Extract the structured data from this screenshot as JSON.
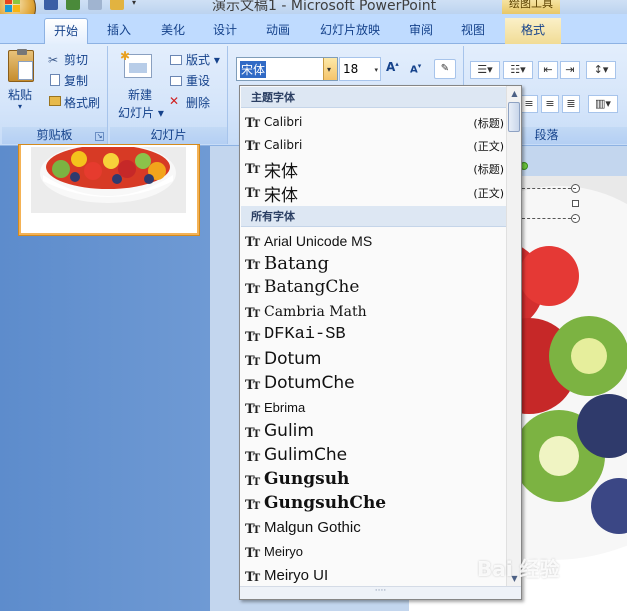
{
  "window": {
    "title": "演示文稿1 - Microsoft PowerPoint",
    "context_tab_group": "绘图工具"
  },
  "tabs": [
    {
      "label": "开始",
      "active": true
    },
    {
      "label": "插入"
    },
    {
      "label": "美化"
    },
    {
      "label": "设计"
    },
    {
      "label": "动画"
    },
    {
      "label": "幻灯片放映"
    },
    {
      "label": "审阅"
    },
    {
      "label": "视图"
    },
    {
      "label": "格式",
      "context": true
    }
  ],
  "ribbon": {
    "clipboard": {
      "paste": "粘贴",
      "cut": "剪切",
      "copy": "复制",
      "format_painter": "格式刷",
      "caption": "剪贴板"
    },
    "slides": {
      "new_slide_line1": "新建",
      "new_slide_line2": "幻灯片 ▾",
      "layout": "版式 ▾",
      "reset": "重设",
      "delete": "删除",
      "caption": "幻灯片"
    },
    "font": {
      "name": "宋体",
      "size": "18"
    },
    "paragraph": {
      "caption": "段落"
    }
  },
  "font_dropdown": {
    "theme_header": "主题字体",
    "theme_fonts": [
      {
        "name": "Calibri",
        "tag": "(标题)"
      },
      {
        "name": "Calibri",
        "tag": "(正文)"
      },
      {
        "name": "宋体",
        "tag": "(标题)"
      },
      {
        "name": "宋体",
        "tag": "(正文)"
      }
    ],
    "all_header": "所有字体",
    "all_fonts": [
      "Arial Unicode MS",
      "Batang",
      "BatangChe",
      "Cambria Math",
      "DFKai-SB",
      "Dotum",
      "DotumChe",
      "Ebrima",
      "Gulim",
      "GulimChe",
      "Gungsuh",
      "GungsuhChe",
      "Malgun Gothic",
      "Meiryo",
      "Meiryo UI"
    ],
    "grip": "····"
  },
  "watermark": "Bai 经验",
  "colors": {
    "ribbon_bg": "#dbe8f9",
    "tab_row": "#bfdbff",
    "slides_panel": "#6592cf",
    "selection": "#316ac5",
    "dropdown_header": "#dde7f3"
  }
}
